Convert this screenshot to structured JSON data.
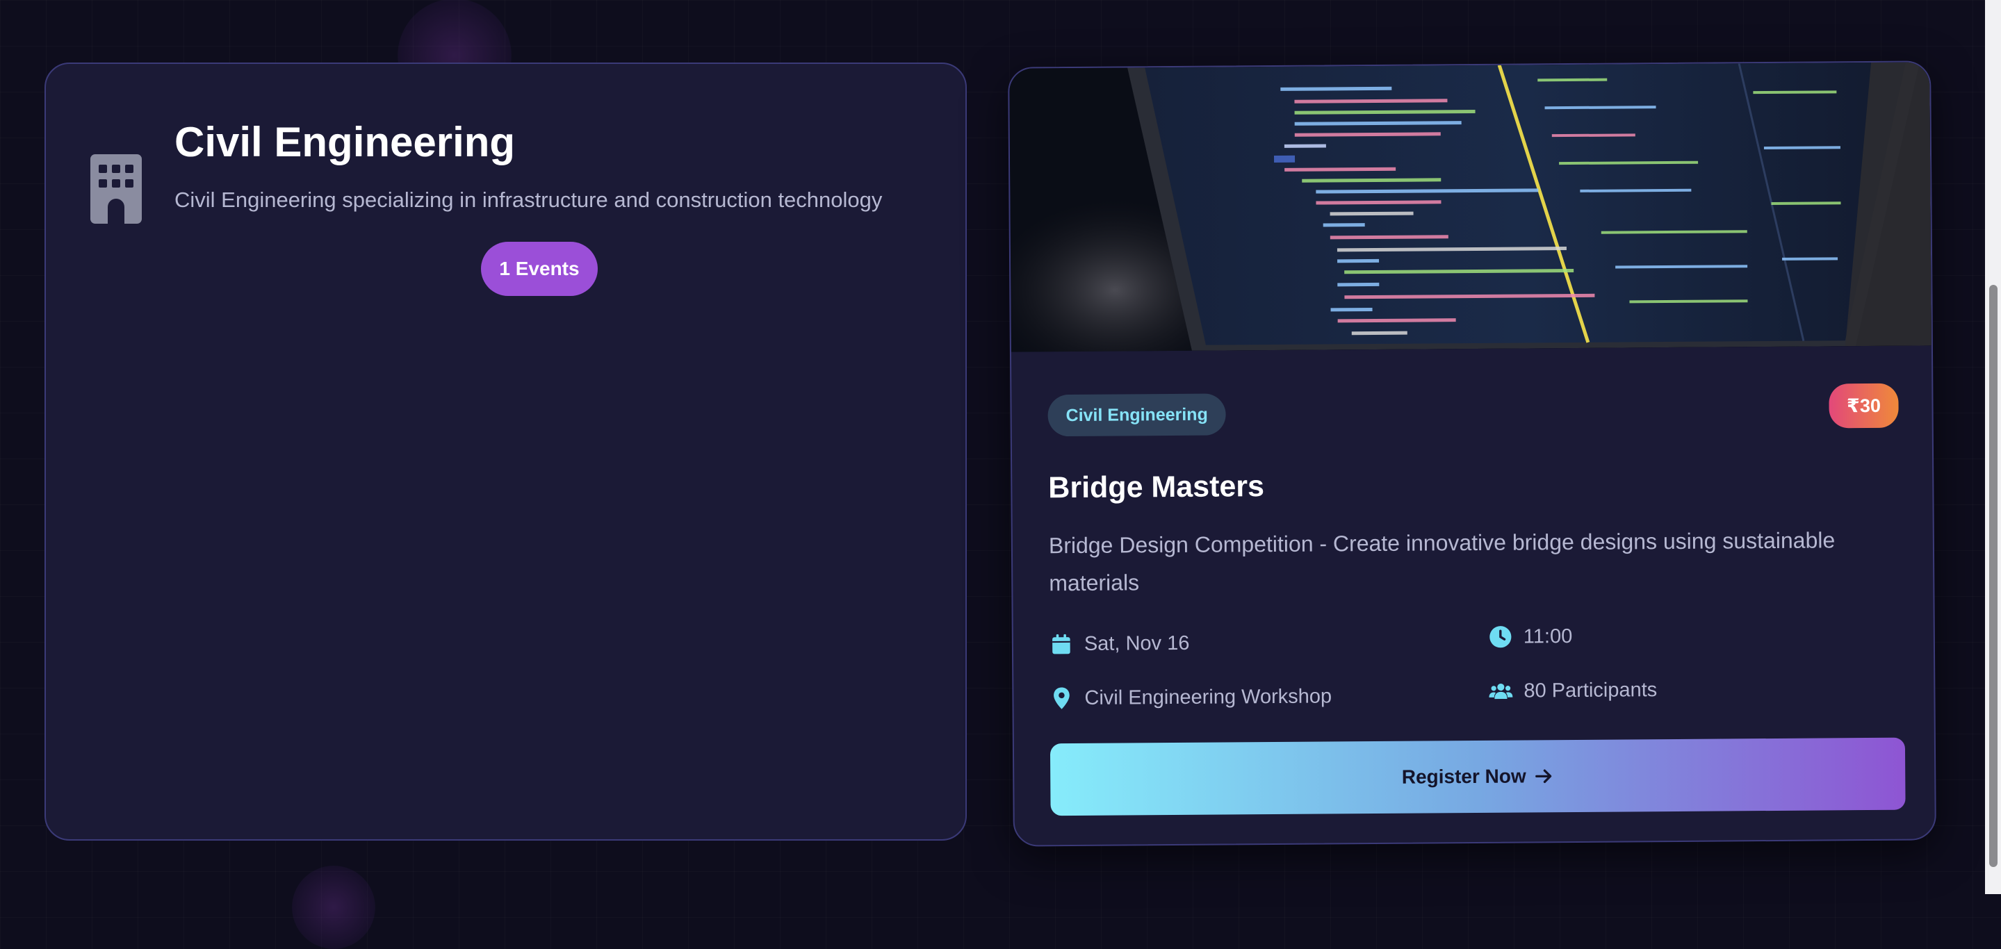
{
  "department": {
    "icon": "building-icon",
    "title": "Civil Engineering",
    "description": "Civil Engineering specializing in infrastructure and construction technology",
    "events_label": "1 Events"
  },
  "event": {
    "image": "laptop-code-photo",
    "category": "Civil Engineering",
    "price": "₹30",
    "title": "Bridge Masters",
    "description": "Bridge Design Competition - Create innovative bridge designs using sustainable materials",
    "date": "Sat, Nov 16",
    "time": "11:00",
    "venue": "Civil Engineering Workshop",
    "participants": "80 Participants",
    "register_label": "Register Now",
    "icons": {
      "date": "calendar-icon",
      "time": "clock-icon",
      "venue": "location-pin-icon",
      "participants": "users-icon",
      "register": "arrow-right-icon"
    }
  },
  "colors": {
    "background": "#0e0d1d",
    "card": "#1b1a36",
    "card_border": "#3b3a78",
    "accent_purple": "#9b4fd8",
    "accent_cyan": "#86e3f7",
    "price_gradient_start": "#e2487a",
    "price_gradient_end": "#ef8a3a"
  }
}
